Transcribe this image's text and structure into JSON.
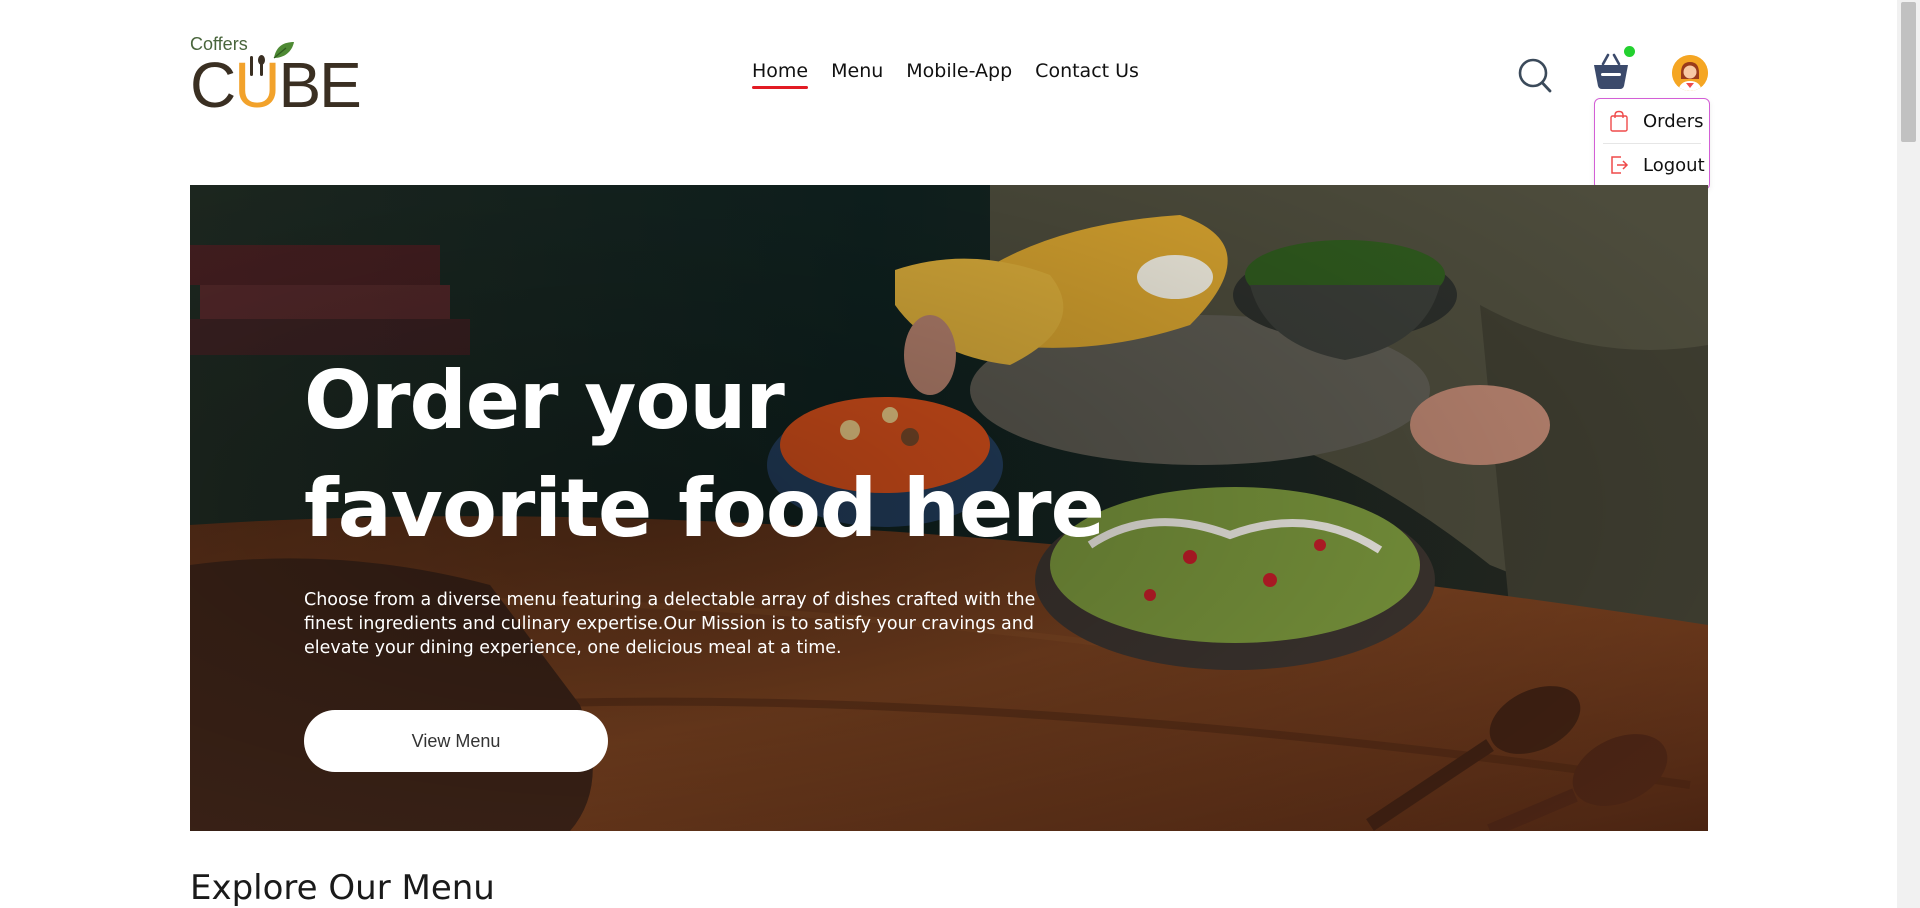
{
  "logo": {
    "small_text": "Coffers",
    "big_text_c": "C",
    "big_text_u": "U",
    "big_text_rest": "BE"
  },
  "nav": {
    "items": [
      {
        "label": "Home",
        "active": true
      },
      {
        "label": "Menu",
        "active": false
      },
      {
        "label": "Mobile-App",
        "active": false
      },
      {
        "label": "Contact Us",
        "active": false
      }
    ]
  },
  "header_icons": {
    "search": "search-icon",
    "cart": "basket-icon",
    "avatar": "user-avatar-icon",
    "cart_status_color": "#23d12f"
  },
  "dropdown": {
    "orders_label": "Orders",
    "logout_label": "Logout",
    "border_color": "#d35fd6",
    "icon_color": "#ef4a4a"
  },
  "hero": {
    "title": "Order your favorite food here",
    "description": "Choose from a diverse menu featuring a delectable array of dishes crafted with the finest ingredients and culinary expertise.Our Mission is to satisfy your cravings and elevate your dining experience, one delicious meal at a time.",
    "button_label": "View Menu"
  },
  "section": {
    "title": "Explore Our Menu"
  },
  "colors": {
    "accent": "#e21b23",
    "logo_green": "#49653c",
    "logo_orange": "#f2a22b",
    "logo_brown": "#3a2f22"
  }
}
